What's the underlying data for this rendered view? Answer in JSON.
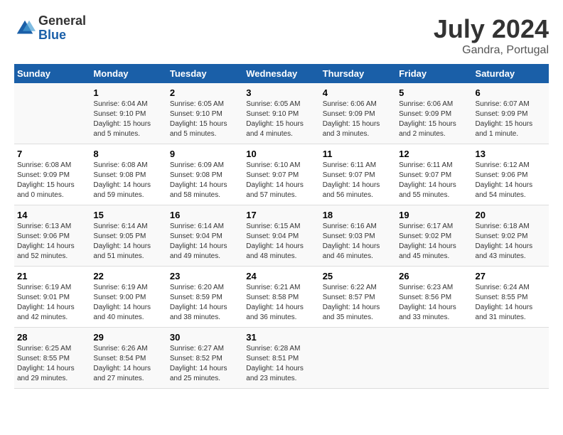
{
  "header": {
    "logo_general": "General",
    "logo_blue": "Blue",
    "month_year": "July 2024",
    "location": "Gandra, Portugal"
  },
  "days_of_week": [
    "Sunday",
    "Monday",
    "Tuesday",
    "Wednesday",
    "Thursday",
    "Friday",
    "Saturday"
  ],
  "weeks": [
    [
      {
        "day": "",
        "info": ""
      },
      {
        "day": "1",
        "info": "Sunrise: 6:04 AM\nSunset: 9:10 PM\nDaylight: 15 hours\nand 5 minutes."
      },
      {
        "day": "2",
        "info": "Sunrise: 6:05 AM\nSunset: 9:10 PM\nDaylight: 15 hours\nand 5 minutes."
      },
      {
        "day": "3",
        "info": "Sunrise: 6:05 AM\nSunset: 9:10 PM\nDaylight: 15 hours\nand 4 minutes."
      },
      {
        "day": "4",
        "info": "Sunrise: 6:06 AM\nSunset: 9:09 PM\nDaylight: 15 hours\nand 3 minutes."
      },
      {
        "day": "5",
        "info": "Sunrise: 6:06 AM\nSunset: 9:09 PM\nDaylight: 15 hours\nand 2 minutes."
      },
      {
        "day": "6",
        "info": "Sunrise: 6:07 AM\nSunset: 9:09 PM\nDaylight: 15 hours\nand 1 minute."
      }
    ],
    [
      {
        "day": "7",
        "info": "Sunrise: 6:08 AM\nSunset: 9:09 PM\nDaylight: 15 hours\nand 0 minutes."
      },
      {
        "day": "8",
        "info": "Sunrise: 6:08 AM\nSunset: 9:08 PM\nDaylight: 14 hours\nand 59 minutes."
      },
      {
        "day": "9",
        "info": "Sunrise: 6:09 AM\nSunset: 9:08 PM\nDaylight: 14 hours\nand 58 minutes."
      },
      {
        "day": "10",
        "info": "Sunrise: 6:10 AM\nSunset: 9:07 PM\nDaylight: 14 hours\nand 57 minutes."
      },
      {
        "day": "11",
        "info": "Sunrise: 6:11 AM\nSunset: 9:07 PM\nDaylight: 14 hours\nand 56 minutes."
      },
      {
        "day": "12",
        "info": "Sunrise: 6:11 AM\nSunset: 9:07 PM\nDaylight: 14 hours\nand 55 minutes."
      },
      {
        "day": "13",
        "info": "Sunrise: 6:12 AM\nSunset: 9:06 PM\nDaylight: 14 hours\nand 54 minutes."
      }
    ],
    [
      {
        "day": "14",
        "info": "Sunrise: 6:13 AM\nSunset: 9:06 PM\nDaylight: 14 hours\nand 52 minutes."
      },
      {
        "day": "15",
        "info": "Sunrise: 6:14 AM\nSunset: 9:05 PM\nDaylight: 14 hours\nand 51 minutes."
      },
      {
        "day": "16",
        "info": "Sunrise: 6:14 AM\nSunset: 9:04 PM\nDaylight: 14 hours\nand 49 minutes."
      },
      {
        "day": "17",
        "info": "Sunrise: 6:15 AM\nSunset: 9:04 PM\nDaylight: 14 hours\nand 48 minutes."
      },
      {
        "day": "18",
        "info": "Sunrise: 6:16 AM\nSunset: 9:03 PM\nDaylight: 14 hours\nand 46 minutes."
      },
      {
        "day": "19",
        "info": "Sunrise: 6:17 AM\nSunset: 9:02 PM\nDaylight: 14 hours\nand 45 minutes."
      },
      {
        "day": "20",
        "info": "Sunrise: 6:18 AM\nSunset: 9:02 PM\nDaylight: 14 hours\nand 43 minutes."
      }
    ],
    [
      {
        "day": "21",
        "info": "Sunrise: 6:19 AM\nSunset: 9:01 PM\nDaylight: 14 hours\nand 42 minutes."
      },
      {
        "day": "22",
        "info": "Sunrise: 6:19 AM\nSunset: 9:00 PM\nDaylight: 14 hours\nand 40 minutes."
      },
      {
        "day": "23",
        "info": "Sunrise: 6:20 AM\nSunset: 8:59 PM\nDaylight: 14 hours\nand 38 minutes."
      },
      {
        "day": "24",
        "info": "Sunrise: 6:21 AM\nSunset: 8:58 PM\nDaylight: 14 hours\nand 36 minutes."
      },
      {
        "day": "25",
        "info": "Sunrise: 6:22 AM\nSunset: 8:57 PM\nDaylight: 14 hours\nand 35 minutes."
      },
      {
        "day": "26",
        "info": "Sunrise: 6:23 AM\nSunset: 8:56 PM\nDaylight: 14 hours\nand 33 minutes."
      },
      {
        "day": "27",
        "info": "Sunrise: 6:24 AM\nSunset: 8:55 PM\nDaylight: 14 hours\nand 31 minutes."
      }
    ],
    [
      {
        "day": "28",
        "info": "Sunrise: 6:25 AM\nSunset: 8:55 PM\nDaylight: 14 hours\nand 29 minutes."
      },
      {
        "day": "29",
        "info": "Sunrise: 6:26 AM\nSunset: 8:54 PM\nDaylight: 14 hours\nand 27 minutes."
      },
      {
        "day": "30",
        "info": "Sunrise: 6:27 AM\nSunset: 8:52 PM\nDaylight: 14 hours\nand 25 minutes."
      },
      {
        "day": "31",
        "info": "Sunrise: 6:28 AM\nSunset: 8:51 PM\nDaylight: 14 hours\nand 23 minutes."
      },
      {
        "day": "",
        "info": ""
      },
      {
        "day": "",
        "info": ""
      },
      {
        "day": "",
        "info": ""
      }
    ]
  ]
}
